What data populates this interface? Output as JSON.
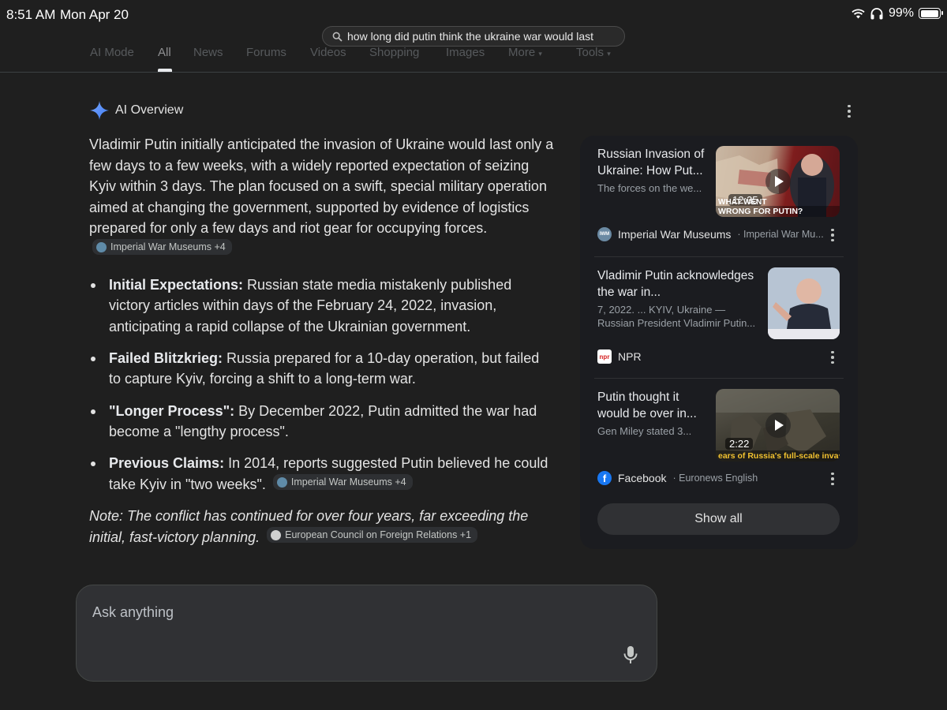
{
  "status_bar": {
    "time": "8:51 AM",
    "date": "Mon Apr 20",
    "battery": "99%",
    "battery_level": 0.99
  },
  "url_bar": {
    "query": "how long did putin think the ukraine war would last"
  },
  "tabs": [
    {
      "label": "AI Mode"
    },
    {
      "label": "All",
      "active": true
    },
    {
      "label": "News"
    },
    {
      "label": "Forums"
    },
    {
      "label": "Videos"
    },
    {
      "label": "Shopping"
    },
    {
      "label": "Images"
    },
    {
      "label": "More"
    },
    {
      "label": "Tools"
    }
  ],
  "ai_overview": {
    "title": "AI Overview",
    "intro": "Vladimir Putin initially anticipated the invasion of Ukraine would last only a few days to a few weeks, with a widely reported expectation of seizing Kyiv within 3 days. The plan focused on a swift, special military operation aimed at changing the government, supported by evidence of logistics prepared for only a few days and riot gear for occupying forces.",
    "intro_chip": "Imperial War Museums +4",
    "bullets": [
      {
        "label": "Initial Expectations:",
        "text": " Russian state media mistakenly published victory articles within days of the February 24, 2022, invasion, anticipating a rapid collapse of the Ukrainian government."
      },
      {
        "label": "Failed Blitzkrieg:",
        "text": " Russia prepared for a 10-day operation, but failed to capture Kyiv, forcing a shift to a long-term war."
      },
      {
        "label": "\"Longer Process\":",
        "text": " By December 2022, Putin admitted the war had become a \"lengthy process\"."
      },
      {
        "label": "Previous Claims:",
        "text": " In 2014, reports suggested Putin believed he could take Kyiv in \"two weeks\".",
        "chip": "Imperial War Museums +4"
      }
    ],
    "note": "Note: The conflict has continued for over four years, far exceeding the initial, fast-victory planning.",
    "note_chip": "European Council on Foreign Relations +1"
  },
  "sources": [
    {
      "title": "Russian Invasion of Ukraine: How Put...",
      "snippet": "The forces on the we...",
      "duration": "12:35",
      "caption": "WRONG FOR PUTIN?",
      "caption_top": "WHAT WENT",
      "source": "Imperial War Museums",
      "sub": "Imperial War Mu...",
      "icon_text": "IWM"
    },
    {
      "title": "Vladimir Putin acknowledges the war in...",
      "snippet": "7, 2022. ... KYIV, Ukraine — Russian President Vladimir Putin...",
      "source": "NPR",
      "icon_text": "npr"
    },
    {
      "title": "Putin thought it would be over in...",
      "snippet": "Gen Miley stated 3...",
      "duration": "2:22",
      "caption": "ears of Russia's full-scale invasion of Ukraine: A",
      "source": "Facebook",
      "sub": "Euronews English",
      "icon_text": "f"
    }
  ],
  "show_all": "Show all",
  "ask": {
    "placeholder": "Ask anything"
  },
  "colors": {
    "background": "#1f1f1f",
    "panel": "#1b1c20",
    "ai_star": "#4f8ef7",
    "facebook": "#1877f2"
  }
}
